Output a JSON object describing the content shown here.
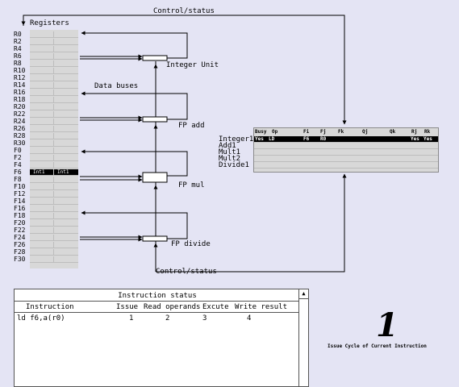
{
  "labels": {
    "control_status_top": "Control/status",
    "control_status_bottom": "Control/status",
    "registers": "Registers",
    "data_buses": "Data buses",
    "integer_unit": "Integer Unit",
    "fp_add": "FP add",
    "fp_mul": "FP mul",
    "fp_divide": "FP divide"
  },
  "registers": [
    "R0",
    "R2",
    "R4",
    "R6",
    "R8",
    "R10",
    "R12",
    "R14",
    "R16",
    "R18",
    "R20",
    "R22",
    "R24",
    "R26",
    "R28",
    "R30",
    "F0",
    "F2",
    "F4",
    "F6",
    "F8",
    "F10",
    "F12",
    "F14",
    "F16",
    "F18",
    "F20",
    "F22",
    "F24",
    "F26",
    "F28",
    "F30"
  ],
  "register_f6": {
    "left": "Int1",
    "right": "Int1"
  },
  "fu_status": {
    "headers": [
      "Busy",
      "Op",
      "Fi",
      "Fj",
      "Fk",
      "Qj",
      "Qk",
      "Rj",
      "Rk"
    ],
    "units": [
      "Integer1",
      "Add1",
      "Mult1",
      "Mult2",
      "Divide1"
    ],
    "integer1": {
      "busy": "Yes",
      "op": "LD",
      "fi": "F6",
      "fj": "R0",
      "rj": "Yes",
      "rk": "Yes"
    }
  },
  "instruction_status": {
    "title": "Instruction status",
    "columns": {
      "instruction": "Instruction",
      "issue": "Issue",
      "read": "Read operands",
      "exec": "Excute",
      "write": "Write result"
    },
    "rows": [
      {
        "instruction": "ld f6,a(r0)",
        "issue": "1",
        "read": "2",
        "exec": "3",
        "write": "4"
      }
    ]
  },
  "scroll_up_arrow": "▲",
  "current_cycle": "1",
  "cycle_caption": "Issue Cycle of Current Instruction",
  "colors": {
    "background": "#e4e4f4",
    "panel": "#d8d8d8",
    "highlight": "#000000"
  }
}
